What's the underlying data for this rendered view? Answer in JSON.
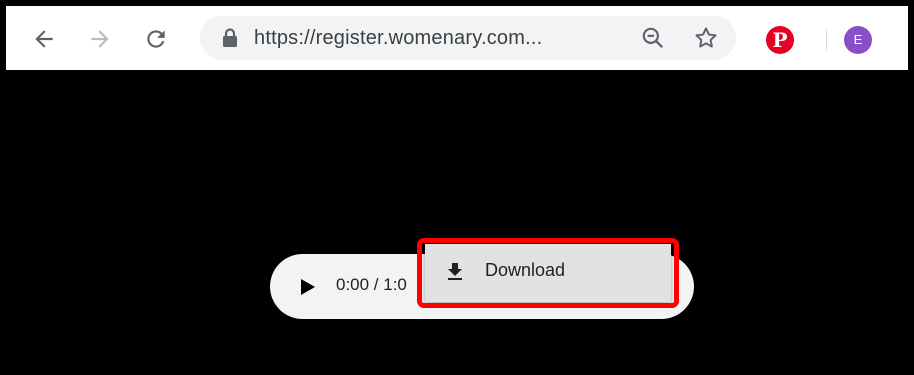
{
  "browser": {
    "address_bar": {
      "url": "https://register.womenary.com..."
    },
    "extensions": {
      "pinterest_glyph": "P"
    },
    "profile": {
      "avatar_initial": "E"
    },
    "icons": [
      "back-arrow-icon",
      "forward-arrow-icon",
      "reload-icon",
      "lock-icon",
      "zoom-icon",
      "bookmark-star-icon",
      "pinterest-icon"
    ]
  },
  "player": {
    "time_text": "0:00 / 1:0"
  },
  "context_menu": {
    "download_label": "Download"
  },
  "colors": {
    "highlight": "#ff0000",
    "pinterest": "#e60023",
    "avatar": "#8a4fc8",
    "page_background": "#000000"
  }
}
